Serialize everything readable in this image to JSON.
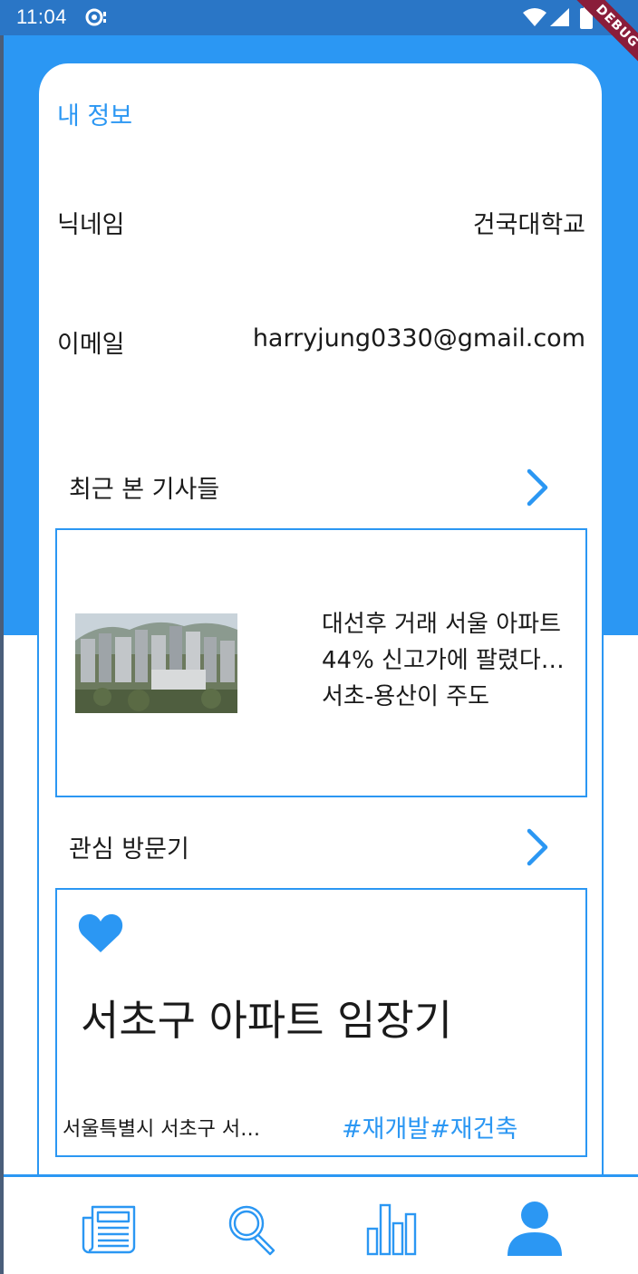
{
  "status_bar": {
    "time": "11:04"
  },
  "debug_banner": "DEBUG",
  "profile": {
    "title": "내 정보",
    "nickname_label": "닉네임",
    "nickname_value": "건국대학교",
    "email_label": "이메일",
    "email_value": "harryjung0330@gmail.com"
  },
  "recent_articles": {
    "heading": "최근 본 기사들",
    "article_title": "대선후 거래 서울 아파트 44% 신고가에 팔렸다…서초-용산이 주도"
  },
  "interest_visits": {
    "heading": "관심 방문기",
    "visit_title": "서초구 아파트 임장기",
    "visit_address": "서울특별시 서초구 서…",
    "visit_tags": "#재개발#재건축"
  },
  "bottom_nav": {
    "items": [
      {
        "icon": "newspaper-icon"
      },
      {
        "icon": "search-icon"
      },
      {
        "icon": "bar-chart-icon"
      },
      {
        "icon": "person-icon",
        "selected": true
      }
    ]
  },
  "colors": {
    "primary": "#2b97f3",
    "status_bar": "#2a76c6",
    "debug": "#8a1d3a"
  }
}
